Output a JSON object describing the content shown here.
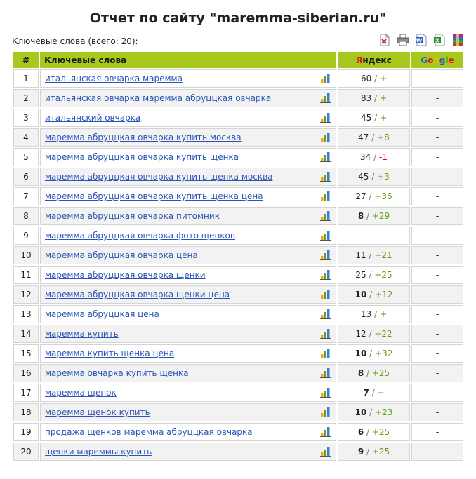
{
  "page": {
    "title": "Отчет по сайту \"maremma-siberian.ru\"",
    "keywords_count_label": "Ключевые слова (всего: 20):"
  },
  "toolbar": {
    "icons": [
      "delete-icon",
      "print-icon",
      "word-export-icon",
      "excel-export-icon",
      "archive-icon"
    ]
  },
  "table": {
    "headers": {
      "num": "#",
      "keywords": "Ключевые слова",
      "yandex_first": "Я",
      "yandex_rest": "ндекс",
      "google_letters": [
        "G",
        "o",
        "o",
        "g",
        "l",
        "e"
      ]
    },
    "google_colors": [
      "#1a5dd8",
      "#e21b1b",
      "#f0b400",
      "#1a5dd8",
      "#2c9a2c",
      "#e21b1b"
    ],
    "rows": [
      {
        "num": "1",
        "keyword": "итальянская овчарка маремма",
        "yandex": "60",
        "bold": false,
        "delta": "+",
        "delta_type": "pos",
        "google": "-"
      },
      {
        "num": "2",
        "keyword": "итальянская овчарка маремма абруццкая овчарка",
        "yandex": "83",
        "bold": false,
        "delta": "+",
        "delta_type": "pos",
        "google": "-"
      },
      {
        "num": "3",
        "keyword": "итальянский овчарка",
        "yandex": "45",
        "bold": false,
        "delta": "+",
        "delta_type": "pos",
        "google": "-"
      },
      {
        "num": "4",
        "keyword": "маремма абруццкая овчарка купить москва",
        "yandex": "47",
        "bold": false,
        "delta": "+8",
        "delta_type": "pos",
        "google": "-"
      },
      {
        "num": "5",
        "keyword": "маремма абруццкая овчарка купить щенка",
        "yandex": "34",
        "bold": false,
        "delta": "-1",
        "delta_type": "neg",
        "google": "-"
      },
      {
        "num": "6",
        "keyword": "маремма абруццкая овчарка купить щенка москва",
        "yandex": "45",
        "bold": false,
        "delta": "+3",
        "delta_type": "pos",
        "google": "-"
      },
      {
        "num": "7",
        "keyword": "маремма абруццкая овчарка купить щенка цена",
        "yandex": "27",
        "bold": false,
        "delta": "+36",
        "delta_type": "pos",
        "google": "-"
      },
      {
        "num": "8",
        "keyword": "маремма абруццкая овчарка питомник",
        "yandex": "8",
        "bold": true,
        "delta": "+29",
        "delta_type": "pos",
        "google": "-"
      },
      {
        "num": "9",
        "keyword": "маремма абруццкая овчарка фото щенков",
        "yandex": "-",
        "bold": false,
        "delta": "",
        "delta_type": "none",
        "google": "-"
      },
      {
        "num": "10",
        "keyword": "маремма абруццкая овчарка цена",
        "yandex": "11",
        "bold": false,
        "delta": "+21",
        "delta_type": "pos",
        "google": "-"
      },
      {
        "num": "11",
        "keyword": "маремма абруццкая овчарка щенки",
        "yandex": "25",
        "bold": false,
        "delta": "+25",
        "delta_type": "pos",
        "google": "-"
      },
      {
        "num": "12",
        "keyword": "маремма абруццкая овчарка щенки цена",
        "yandex": "10",
        "bold": true,
        "delta": "+12",
        "delta_type": "pos",
        "google": "-"
      },
      {
        "num": "13",
        "keyword": "маремма абруццкая цена",
        "yandex": "13",
        "bold": false,
        "delta": "+",
        "delta_type": "pos",
        "google": "-"
      },
      {
        "num": "14",
        "keyword": "маремма купить",
        "yandex": "12",
        "bold": false,
        "delta": "+22",
        "delta_type": "pos",
        "google": "-"
      },
      {
        "num": "15",
        "keyword": "маремма купить щенка цена",
        "yandex": "10",
        "bold": true,
        "delta": "+32",
        "delta_type": "pos",
        "google": "-"
      },
      {
        "num": "16",
        "keyword": "маремма овчарка купить щенка",
        "yandex": "8",
        "bold": true,
        "delta": "+25",
        "delta_type": "pos",
        "google": "-"
      },
      {
        "num": "17",
        "keyword": "маремма щенок",
        "yandex": "7",
        "bold": true,
        "delta": "+",
        "delta_type": "pos",
        "google": "-"
      },
      {
        "num": "18",
        "keyword": "маремма щенок купить",
        "yandex": "10",
        "bold": true,
        "delta": "+23",
        "delta_type": "pos",
        "google": "-"
      },
      {
        "num": "19",
        "keyword": "продажа щенков маремма абруццкая овчарка",
        "yandex": "6",
        "bold": true,
        "delta": "+25",
        "delta_type": "pos",
        "google": "-"
      },
      {
        "num": "20",
        "keyword": "щенки мареммы купить",
        "yandex": "9",
        "bold": true,
        "delta": "+25",
        "delta_type": "pos",
        "google": "-"
      }
    ]
  }
}
